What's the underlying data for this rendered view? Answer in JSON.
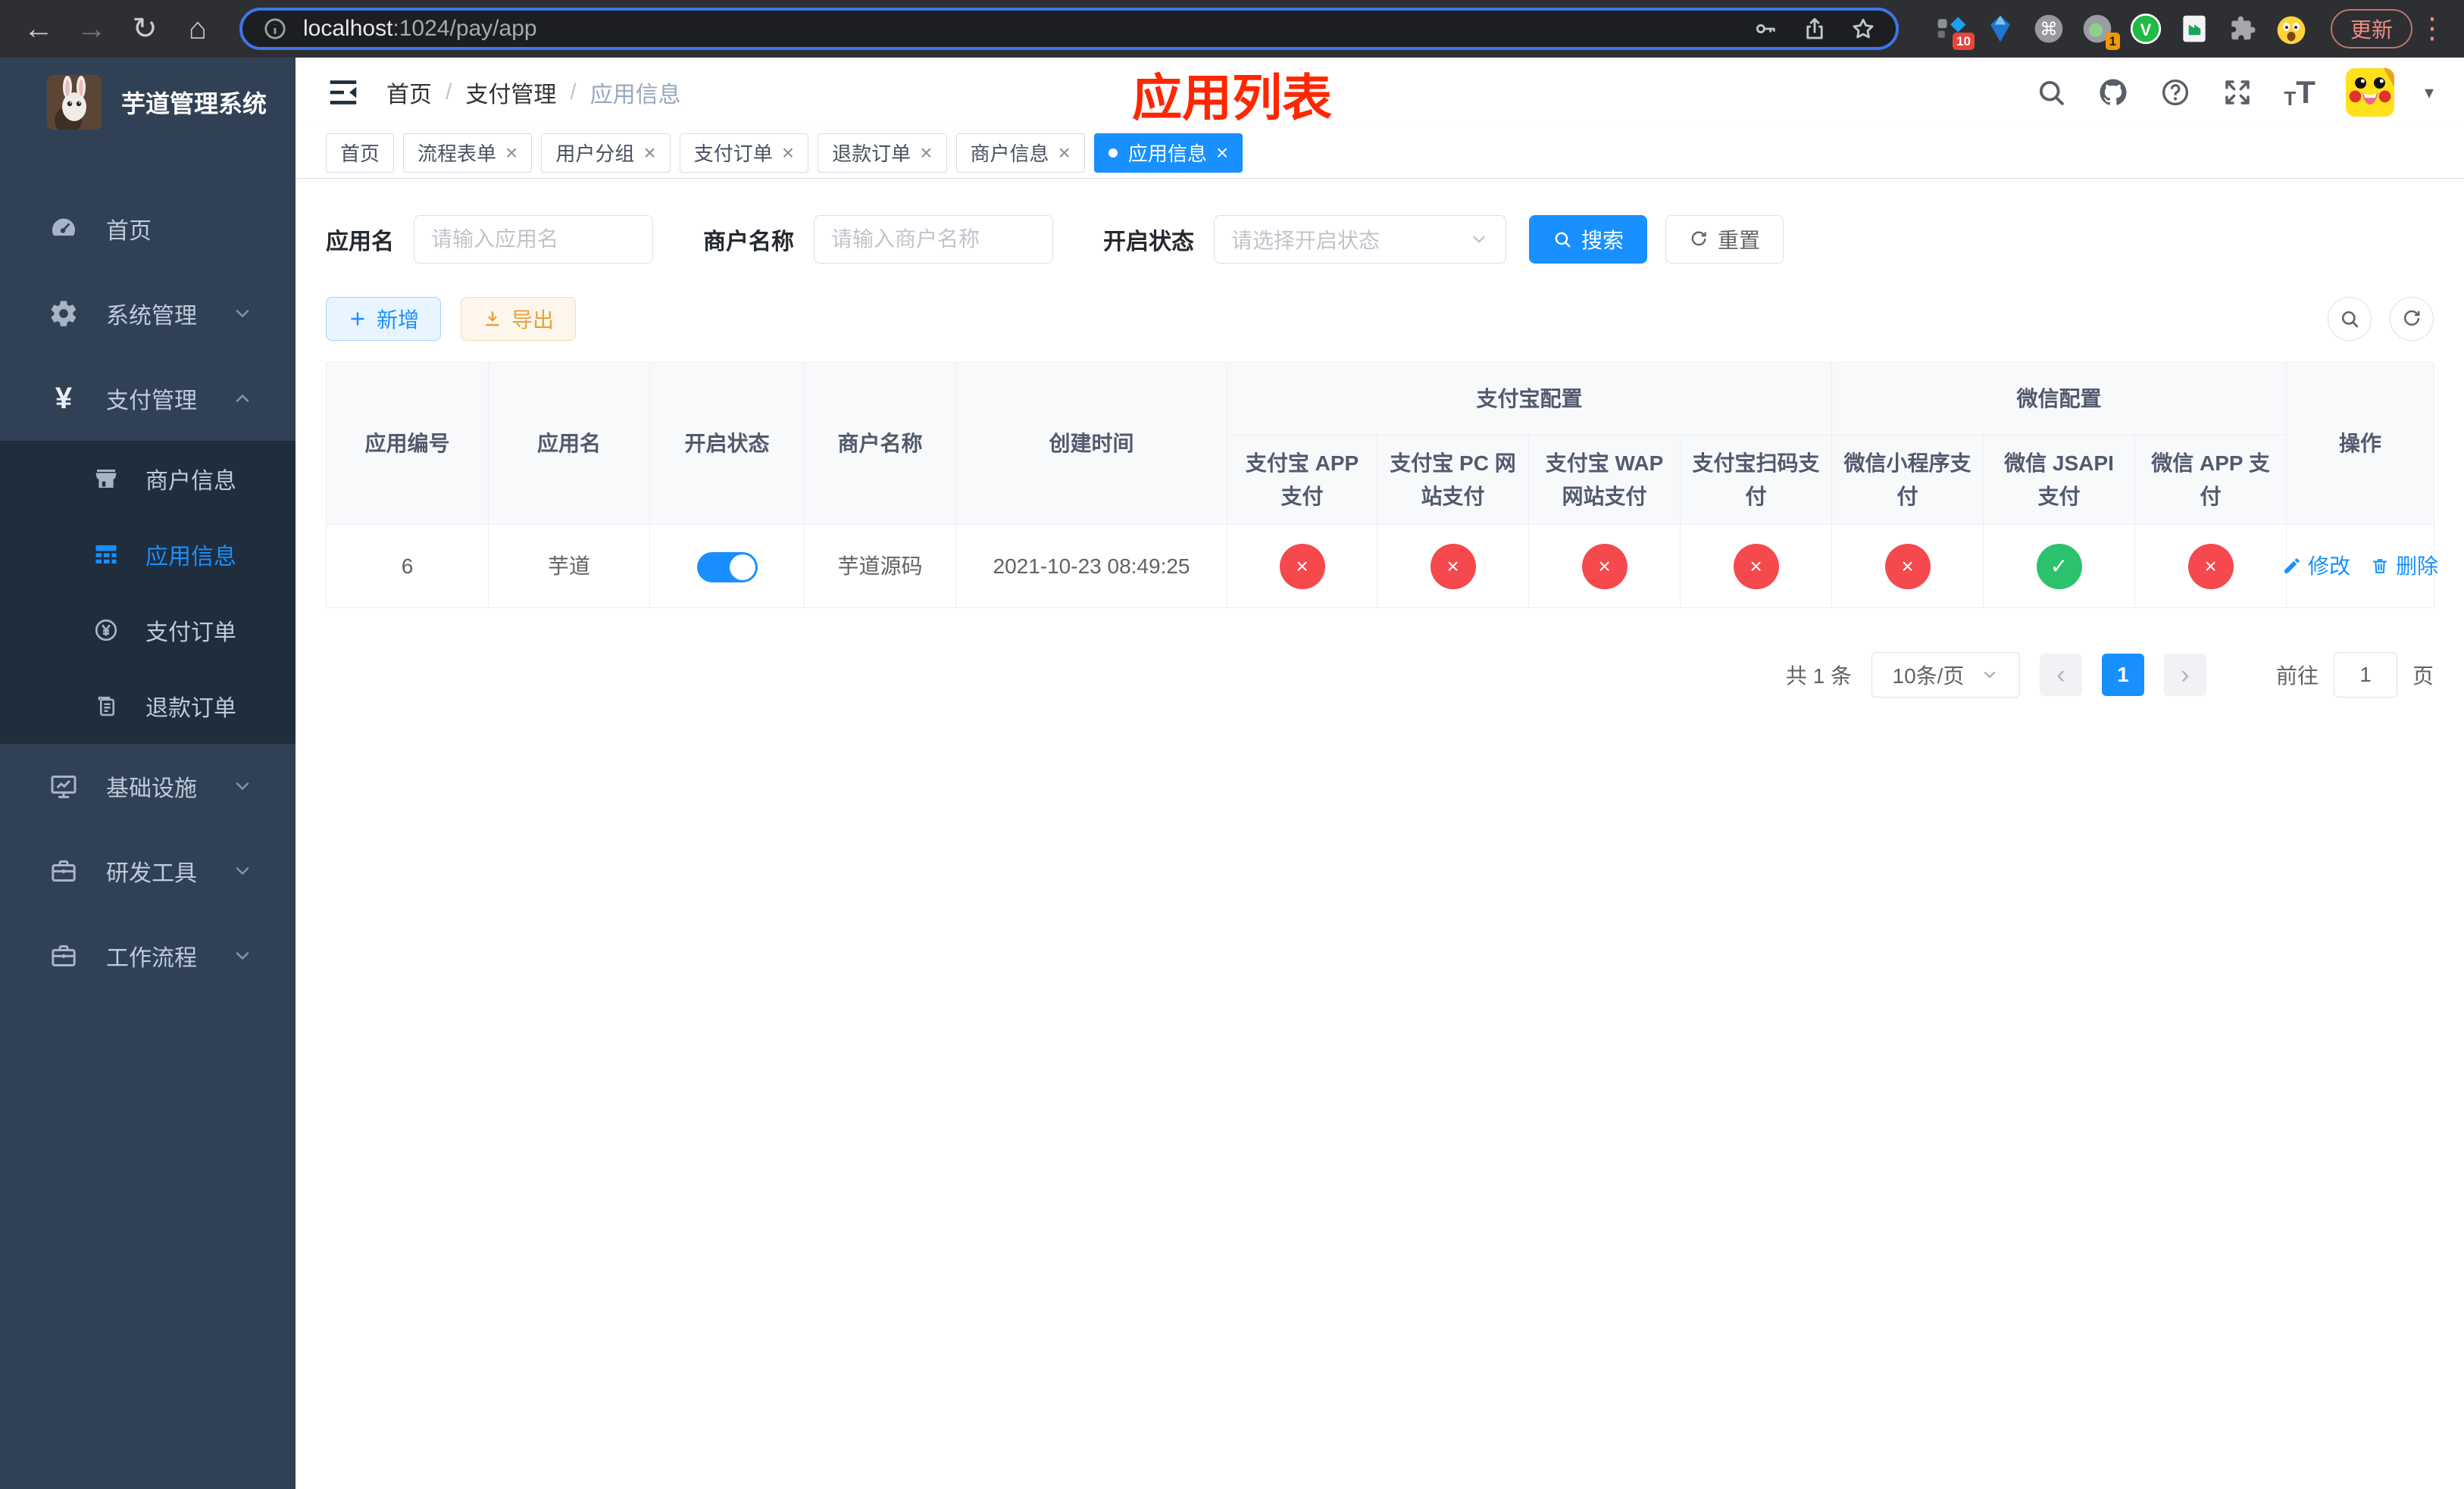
{
  "colors": {
    "primary": "#1890ff",
    "success": "#2bc26d",
    "danger": "#f5494d",
    "warning": "#e6a23c"
  },
  "icons": {
    "back": "←",
    "forward": "→",
    "reload": "↻",
    "home": "⌂",
    "menu_dots": "⋮",
    "caret_down": "▾",
    "close": "×",
    "prev": "‹",
    "next": "›",
    "check": "✓",
    "cross": "×",
    "yen": "¥",
    "font_size_small": "T",
    "font_size_large": "T",
    "command": "⌘",
    "v_mark": "V"
  },
  "browser": {
    "url_host": "localhost",
    "url_rest": ":1024/pay/app",
    "update_label": "更新",
    "ext_badge_1": "10",
    "ext_badge_2": "1"
  },
  "sidebar": {
    "title": "芋道管理系统",
    "items": [
      {
        "label": "首页"
      },
      {
        "label": "系统管理"
      },
      {
        "label": "支付管理"
      },
      {
        "label": "基础设施"
      },
      {
        "label": "研发工具"
      },
      {
        "label": "工作流程"
      }
    ],
    "pay_children": [
      {
        "label": "商户信息"
      },
      {
        "label": "应用信息"
      },
      {
        "label": "支付订单"
      },
      {
        "label": "退款订单"
      }
    ]
  },
  "navbar": {
    "breadcrumb": [
      "首页",
      "支付管理",
      "应用信息"
    ]
  },
  "overlay_title": "应用列表",
  "tabs": [
    {
      "label": "首页"
    },
    {
      "label": "流程表单"
    },
    {
      "label": "用户分组"
    },
    {
      "label": "支付订单"
    },
    {
      "label": "退款订单"
    },
    {
      "label": "商户信息"
    },
    {
      "label": "应用信息"
    }
  ],
  "filters": {
    "app_name": {
      "label": "应用名",
      "placeholder": "请输入应用名",
      "value": ""
    },
    "merchant": {
      "label": "商户名称",
      "placeholder": "请输入商户名称",
      "value": ""
    },
    "status": {
      "label": "开启状态",
      "placeholder": "请选择开启状态"
    },
    "search_label": "搜索",
    "reset_label": "重置"
  },
  "toolbar": {
    "add_label": "新增",
    "export_label": "导出"
  },
  "table": {
    "main_left": [
      "应用编号",
      "应用名",
      "开启状态",
      "商户名称",
      "创建时间"
    ],
    "group_alipay": {
      "label": "支付宝配置",
      "children": [
        "支付宝 APP 支付",
        "支付宝 PC 网站支付",
        "支付宝 WAP 网站支付",
        "支付宝扫码支付"
      ]
    },
    "group_wechat": {
      "label": "微信配置",
      "children": [
        "微信小程序支付",
        "微信 JSAPI 支付",
        "微信 APP 支付"
      ]
    },
    "action_col": "操作",
    "row": {
      "id": "6",
      "name": "芋道",
      "enabled": true,
      "merchant": "芋道源码",
      "created": "2021-10-23 08:49:25",
      "statuses": [
        false,
        false,
        false,
        false,
        false,
        true,
        false
      ],
      "edit_label": "修改",
      "delete_label": "删除"
    }
  },
  "pagination": {
    "total": "共 1 条",
    "page_size": "10条/页",
    "page": "1",
    "goto_prefix": "前往",
    "goto_value": "1",
    "goto_suffix": "页"
  }
}
